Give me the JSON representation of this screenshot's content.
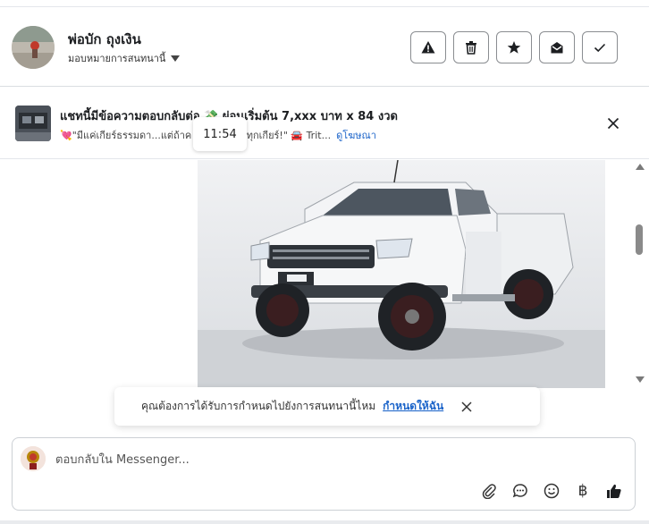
{
  "header": {
    "name": "พ่อบัก ถุงเงิน",
    "assign_label": "มอบหมายการสนทนานี้",
    "action_icons": [
      "alert-icon",
      "trash-icon",
      "star-icon",
      "envelope-open-icon",
      "check-icon"
    ]
  },
  "ad": {
    "title": "แชทนี้มีข้อความตอบกลับต่อ 💸 ผ่อนเริ่มต้น 7,xxx บาท x 84 งวด",
    "subtitle_start": "💘\"มีแค่เกียร์ธรรมดา...แต่ถ้าค",
    "subtitle_end": "รองว่าพิเศษทุกเกียร์!\" 🚘 Trit...",
    "link": "ดูโฆษณา",
    "tooltip_time": "11:54"
  },
  "prompt": {
    "text": "คุณต้องการได้รับการกำหนดไปยังการสนทนานี้ไหม",
    "link": "กำหนดให้ฉัน"
  },
  "composer": {
    "placeholder": "ตอบกลับใน Messenger...",
    "tools": [
      "paperclip-icon",
      "chat-bubble-icon",
      "smiley-icon",
      "baht-icon",
      "thumbs-up-icon"
    ],
    "baht_symbol": "฿"
  },
  "colors": {
    "link": "#1a63c9",
    "border": "#8a8d91"
  }
}
